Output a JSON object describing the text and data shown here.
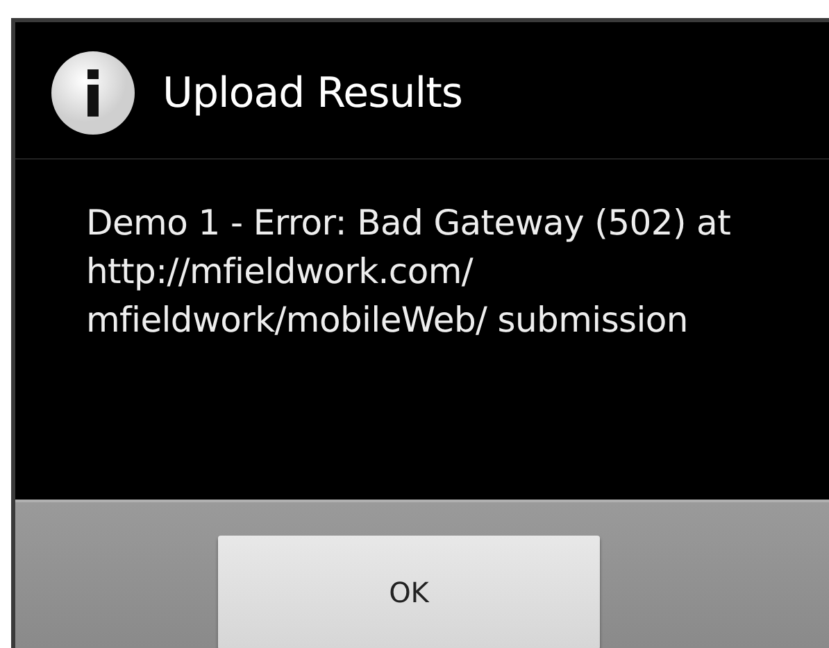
{
  "dialog": {
    "title": "Upload Results",
    "message": "Demo 1 - Error: Bad Gateway (502) at http://mfieldwork.com/ mfieldwork/mobileWeb/ submission",
    "buttons": [
      "OK"
    ]
  }
}
